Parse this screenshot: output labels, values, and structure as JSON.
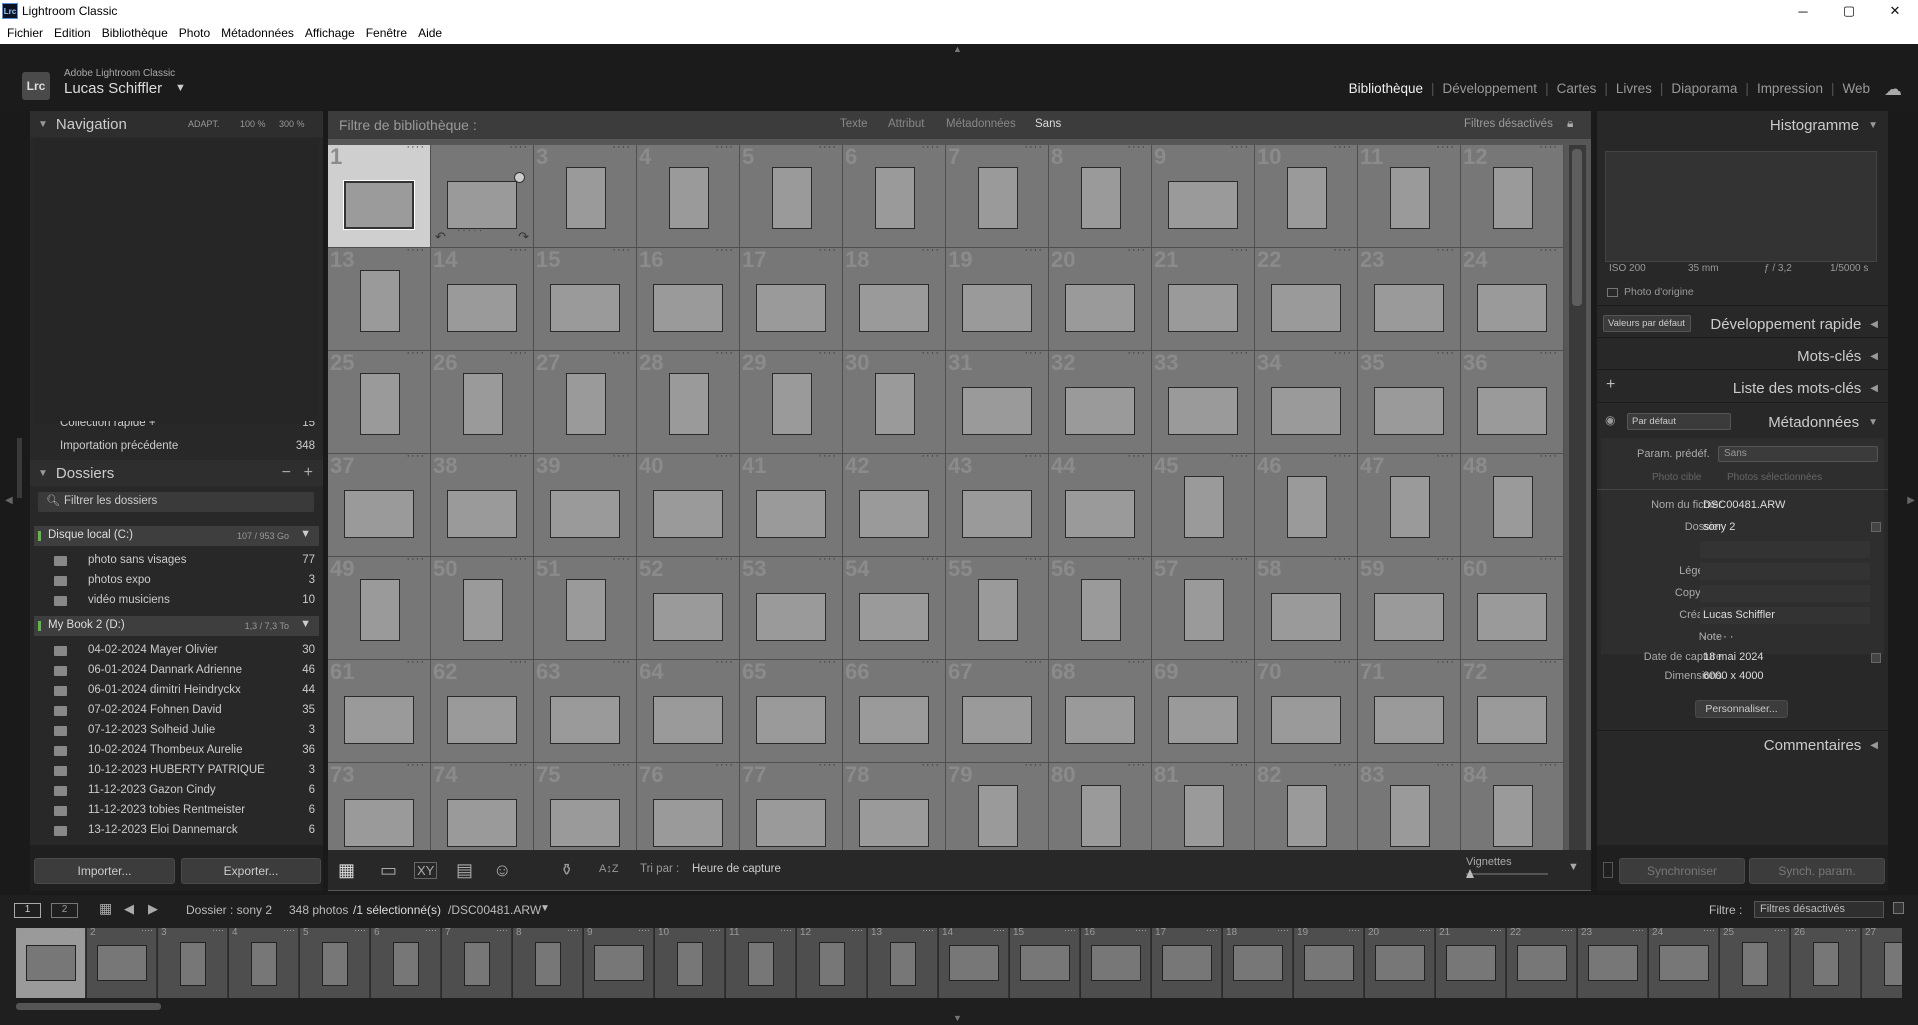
{
  "window": {
    "title": "Lightroom Classic",
    "minimize": "─",
    "maximize": "▢",
    "close": "✕"
  },
  "menu": [
    "Fichier",
    "Edition",
    "Bibliothèque",
    "Photo",
    "Métadonnées",
    "Affichage",
    "Fenêtre",
    "Aide"
  ],
  "identity": {
    "logo": "Lrc",
    "product": "Adobe Lightroom Classic",
    "user": "Lucas Schiffler",
    "caret": "▼"
  },
  "modules": [
    {
      "label": "Bibliothèque",
      "active": true
    },
    {
      "label": "Développement",
      "active": false
    },
    {
      "label": "Cartes",
      "active": false
    },
    {
      "label": "Livres",
      "active": false
    },
    {
      "label": "Diaporama",
      "active": false
    },
    {
      "label": "Impression",
      "active": false
    },
    {
      "label": "Web",
      "active": false
    }
  ],
  "navigator": {
    "title": "Navigation",
    "adapt": "ADAPT.",
    "z100": "100 %",
    "z300": "300 %"
  },
  "catalog": {
    "items": [
      {
        "label": "Collection rapide +",
        "count": "15"
      },
      {
        "label": "Importation précédente",
        "count": "348"
      }
    ]
  },
  "folders": {
    "title": "Dossiers",
    "filter_placeholder": "Filtrer les dossiers",
    "volumes": [
      {
        "name": "Disque local (C:)",
        "info": "107 / 953 Go",
        "items": [
          {
            "label": "photo sans visages",
            "count": "77"
          },
          {
            "label": "photos expo",
            "count": "3"
          },
          {
            "label": "vidéo musiciens",
            "count": "10"
          }
        ]
      },
      {
        "name": "My Book 2 (D:)",
        "info": "1,3 / 7,3 To",
        "items": [
          {
            "label": "04-02-2024 Mayer Olivier",
            "count": "30"
          },
          {
            "label": "06-01-2024 Dannark Adrienne",
            "count": "46"
          },
          {
            "label": "06-01-2024 dimitri Heindryckx",
            "count": "44"
          },
          {
            "label": "07-02-2024 Fohnen David",
            "count": "35"
          },
          {
            "label": "07-12-2023 Solheid Julie",
            "count": "3"
          },
          {
            "label": "10-02-2024 Thombeux Aurelie",
            "count": "36"
          },
          {
            "label": "10-12-2023 HUBERTY PATRIQUE",
            "count": "3"
          },
          {
            "label": "11-12-2023 Gazon Cindy",
            "count": "6"
          },
          {
            "label": "11-12-2023 tobies Rentmeister",
            "count": "6"
          },
          {
            "label": "13-12-2023 Eloi Dannemarck",
            "count": "6"
          }
        ]
      }
    ]
  },
  "left_buttons": {
    "import": "Importer...",
    "export": "Exporter..."
  },
  "filter_bar": {
    "title": "Filtre de bibliothèque :",
    "tabs": [
      "Texte",
      "Attribut",
      "Métadonnées",
      "Sans"
    ],
    "active_tab": "Sans",
    "preset": "Filtres désactivés"
  },
  "grid": {
    "cells": [
      {
        "n": "1",
        "o": "land"
      },
      {
        "n": "",
        "o": "land"
      },
      {
        "n": "3",
        "o": "port"
      },
      {
        "n": "4",
        "o": "port"
      },
      {
        "n": "5",
        "o": "port"
      },
      {
        "n": "6",
        "o": "port"
      },
      {
        "n": "7",
        "o": "port"
      },
      {
        "n": "8",
        "o": "port"
      },
      {
        "n": "9",
        "o": "land"
      },
      {
        "n": "10",
        "o": "port"
      },
      {
        "n": "11",
        "o": "port"
      },
      {
        "n": "12",
        "o": "port"
      },
      {
        "n": "13",
        "o": "port"
      },
      {
        "n": "14",
        "o": "land"
      },
      {
        "n": "15",
        "o": "land"
      },
      {
        "n": "16",
        "o": "land"
      },
      {
        "n": "17",
        "o": "land"
      },
      {
        "n": "18",
        "o": "land"
      },
      {
        "n": "19",
        "o": "land"
      },
      {
        "n": "20",
        "o": "land"
      },
      {
        "n": "21",
        "o": "land"
      },
      {
        "n": "22",
        "o": "land"
      },
      {
        "n": "23",
        "o": "land"
      },
      {
        "n": "24",
        "o": "land"
      },
      {
        "n": "25",
        "o": "port"
      },
      {
        "n": "26",
        "o": "port"
      },
      {
        "n": "27",
        "o": "port"
      },
      {
        "n": "28",
        "o": "port"
      },
      {
        "n": "29",
        "o": "port"
      },
      {
        "n": "30",
        "o": "port"
      },
      {
        "n": "31",
        "o": "land"
      },
      {
        "n": "32",
        "o": "land"
      },
      {
        "n": "33",
        "o": "land"
      },
      {
        "n": "34",
        "o": "land"
      },
      {
        "n": "35",
        "o": "land"
      },
      {
        "n": "36",
        "o": "land"
      },
      {
        "n": "37",
        "o": "land"
      },
      {
        "n": "38",
        "o": "land"
      },
      {
        "n": "39",
        "o": "land"
      },
      {
        "n": "40",
        "o": "land"
      },
      {
        "n": "41",
        "o": "land"
      },
      {
        "n": "42",
        "o": "land"
      },
      {
        "n": "43",
        "o": "land"
      },
      {
        "n": "44",
        "o": "land"
      },
      {
        "n": "45",
        "o": "port"
      },
      {
        "n": "46",
        "o": "port"
      },
      {
        "n": "47",
        "o": "port"
      },
      {
        "n": "48",
        "o": "port"
      },
      {
        "n": "49",
        "o": "port"
      },
      {
        "n": "50",
        "o": "port"
      },
      {
        "n": "51",
        "o": "port"
      },
      {
        "n": "52",
        "o": "land"
      },
      {
        "n": "53",
        "o": "land"
      },
      {
        "n": "54",
        "o": "land"
      },
      {
        "n": "55",
        "o": "port"
      },
      {
        "n": "56",
        "o": "port"
      },
      {
        "n": "57",
        "o": "port"
      },
      {
        "n": "58",
        "o": "land"
      },
      {
        "n": "59",
        "o": "land"
      },
      {
        "n": "60",
        "o": "land"
      },
      {
        "n": "61",
        "o": "land"
      },
      {
        "n": "62",
        "o": "land"
      },
      {
        "n": "63",
        "o": "land"
      },
      {
        "n": "64",
        "o": "land"
      },
      {
        "n": "65",
        "o": "land"
      },
      {
        "n": "66",
        "o": "land"
      },
      {
        "n": "67",
        "o": "land"
      },
      {
        "n": "68",
        "o": "land"
      },
      {
        "n": "69",
        "o": "land"
      },
      {
        "n": "70",
        "o": "land"
      },
      {
        "n": "71",
        "o": "land"
      },
      {
        "n": "72",
        "o": "land"
      },
      {
        "n": "73",
        "o": "land"
      },
      {
        "n": "74",
        "o": "land"
      },
      {
        "n": "75",
        "o": "land"
      },
      {
        "n": "76",
        "o": "land"
      },
      {
        "n": "77",
        "o": "land"
      },
      {
        "n": "78",
        "o": "land"
      },
      {
        "n": "79",
        "o": "port"
      },
      {
        "n": "80",
        "o": "port"
      },
      {
        "n": "81",
        "o": "port"
      },
      {
        "n": "82",
        "o": "port"
      },
      {
        "n": "83",
        "o": "port"
      },
      {
        "n": "84",
        "o": "port"
      }
    ],
    "dots": "····",
    "selected_index": 0,
    "cell2_stars": "· · · · ·"
  },
  "toolbar": {
    "sort_label": "Tri par :",
    "sort_value": "Heure de capture",
    "thumb_label": "Vignettes",
    "sort_icon": "A↕Z"
  },
  "histogram": {
    "title": "Histogramme",
    "iso": "ISO 200",
    "focal": "35 mm",
    "aperture": "ƒ / 3,2",
    "shutter": "1/5000 s",
    "original": "Photo d'origine"
  },
  "quick_dev": {
    "title": "Développement rapide",
    "preset": "Valeurs par défaut"
  },
  "keywords": {
    "title": "Mots-clés"
  },
  "keyword_list": {
    "title": "Liste des mots-clés",
    "plus": "+"
  },
  "metadata": {
    "title": "Métadonnées",
    "preset_select": "Par défaut",
    "param_label": "Param. prédéf.",
    "param_value": "Sans",
    "tab_target": "Photo cible",
    "tab_selected": "Photos sélectionnées",
    "fields": [
      {
        "key": "Nom du fichier",
        "value": "DSC00481.ARW"
      },
      {
        "key": "Dossier",
        "value": "sony 2"
      },
      {
        "key": "Titre",
        "value": ""
      },
      {
        "key": "Légende",
        "value": ""
      },
      {
        "key": "Copyright",
        "value": ""
      },
      {
        "key": "Créateur",
        "value": "Lucas Schiffler"
      },
      {
        "key": "Note",
        "value": "·  ·  ·  ·  ·"
      },
      {
        "key": "Date de capture",
        "value": "18 mai 2024"
      },
      {
        "key": "Dimensions",
        "value": "6000 x 4000"
      }
    ],
    "customize": "Personnaliser..."
  },
  "comments": {
    "title": "Commentaires"
  },
  "sync": {
    "sync": "Synchroniser",
    "sync_settings": "Synch. param."
  },
  "footer": {
    "screen1": "1",
    "screen2": "2",
    "folder_label": "Dossier : sony 2",
    "count": "348 photos",
    "selected": "/1 sélectionné(s)",
    "file": "/DSC00481.ARW",
    "filter_label": "Filtre :",
    "filter_value": "Filtres désactivés"
  },
  "filmstrip": {
    "cells": [
      {
        "n": "1",
        "o": "land"
      },
      {
        "n": "2",
        "o": "land"
      },
      {
        "n": "3",
        "o": "port"
      },
      {
        "n": "4",
        "o": "port"
      },
      {
        "n": "5",
        "o": "port"
      },
      {
        "n": "6",
        "o": "port"
      },
      {
        "n": "7",
        "o": "port"
      },
      {
        "n": "8",
        "o": "port"
      },
      {
        "n": "9",
        "o": "land"
      },
      {
        "n": "10",
        "o": "port"
      },
      {
        "n": "11",
        "o": "port"
      },
      {
        "n": "12",
        "o": "port"
      },
      {
        "n": "13",
        "o": "port"
      },
      {
        "n": "14",
        "o": "land"
      },
      {
        "n": "15",
        "o": "land"
      },
      {
        "n": "16",
        "o": "land"
      },
      {
        "n": "17",
        "o": "land"
      },
      {
        "n": "18",
        "o": "land"
      },
      {
        "n": "19",
        "o": "land"
      },
      {
        "n": "20",
        "o": "land"
      },
      {
        "n": "21",
        "o": "land"
      },
      {
        "n": "22",
        "o": "land"
      },
      {
        "n": "23",
        "o": "land"
      },
      {
        "n": "24",
        "o": "land"
      },
      {
        "n": "25",
        "o": "port"
      },
      {
        "n": "26",
        "o": "port"
      },
      {
        "n": "27",
        "o": "port"
      }
    ],
    "dots": "····"
  }
}
